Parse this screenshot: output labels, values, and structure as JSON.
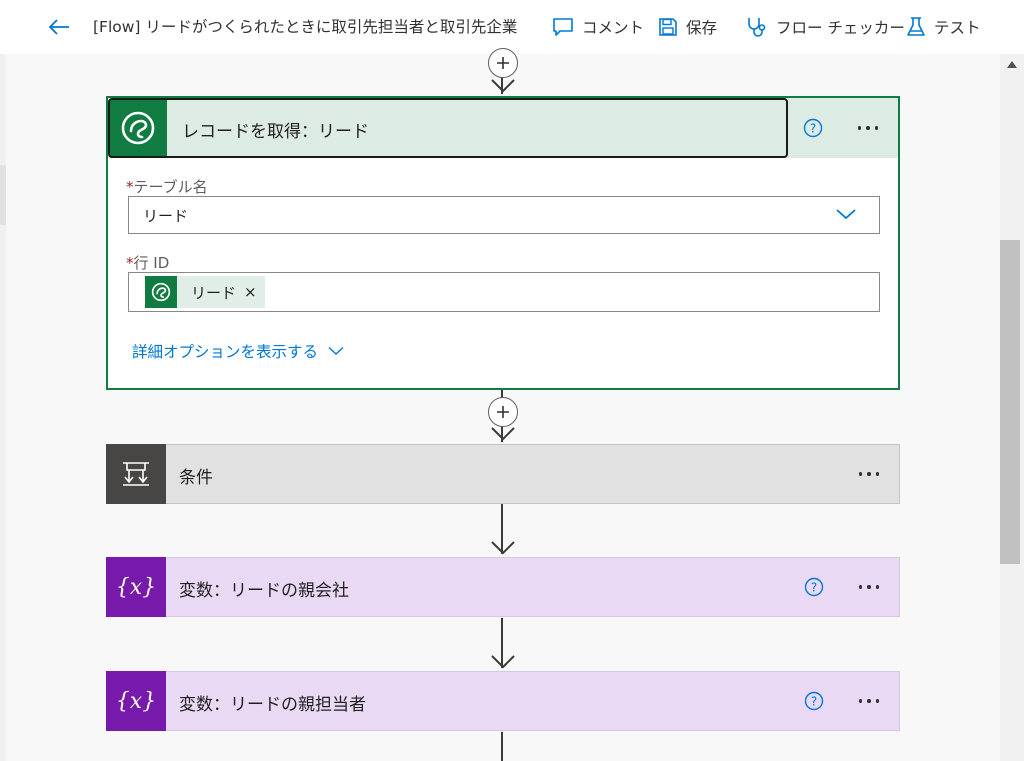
{
  "header": {
    "title": "[Flow] リードがつくられたときに取引先担当者と取引先企業",
    "comment_label": "コメント",
    "save_label": "保存",
    "flow_checker_label": "フロー チェッカー",
    "test_label": "テスト"
  },
  "action_card": {
    "title": "レコードを取得：リード",
    "table_name": {
      "required_mark": "*",
      "label": "テーブル名",
      "value": "リード"
    },
    "row_id": {
      "required_mark": "*",
      "label": "行 ID",
      "token_label": "リード",
      "token_remove": "×"
    },
    "advanced_options_label": "詳細オプションを表示する"
  },
  "condition_card": {
    "title": "条件"
  },
  "variable_cards": [
    {
      "title": "変数：リードの親会社"
    },
    {
      "title": "変数：リードの親担当者"
    }
  ],
  "colors": {
    "dataverse_green": "#107c41",
    "action_header_bg": "#dcebe3",
    "condition_icon_bg": "#484644",
    "variable_icon_bg": "#7719aa",
    "variable_bg": "#ead9f5",
    "link_blue": "#0078d4"
  },
  "icons": {
    "back": "arrow-left-icon",
    "comment": "comment-icon",
    "save": "save-icon",
    "flow_checker": "stethoscope-icon",
    "test": "flask-icon",
    "dataverse": "dataverse-icon",
    "condition": "condition-icon",
    "variable": "variable-icon",
    "help": "help-circle-icon"
  }
}
